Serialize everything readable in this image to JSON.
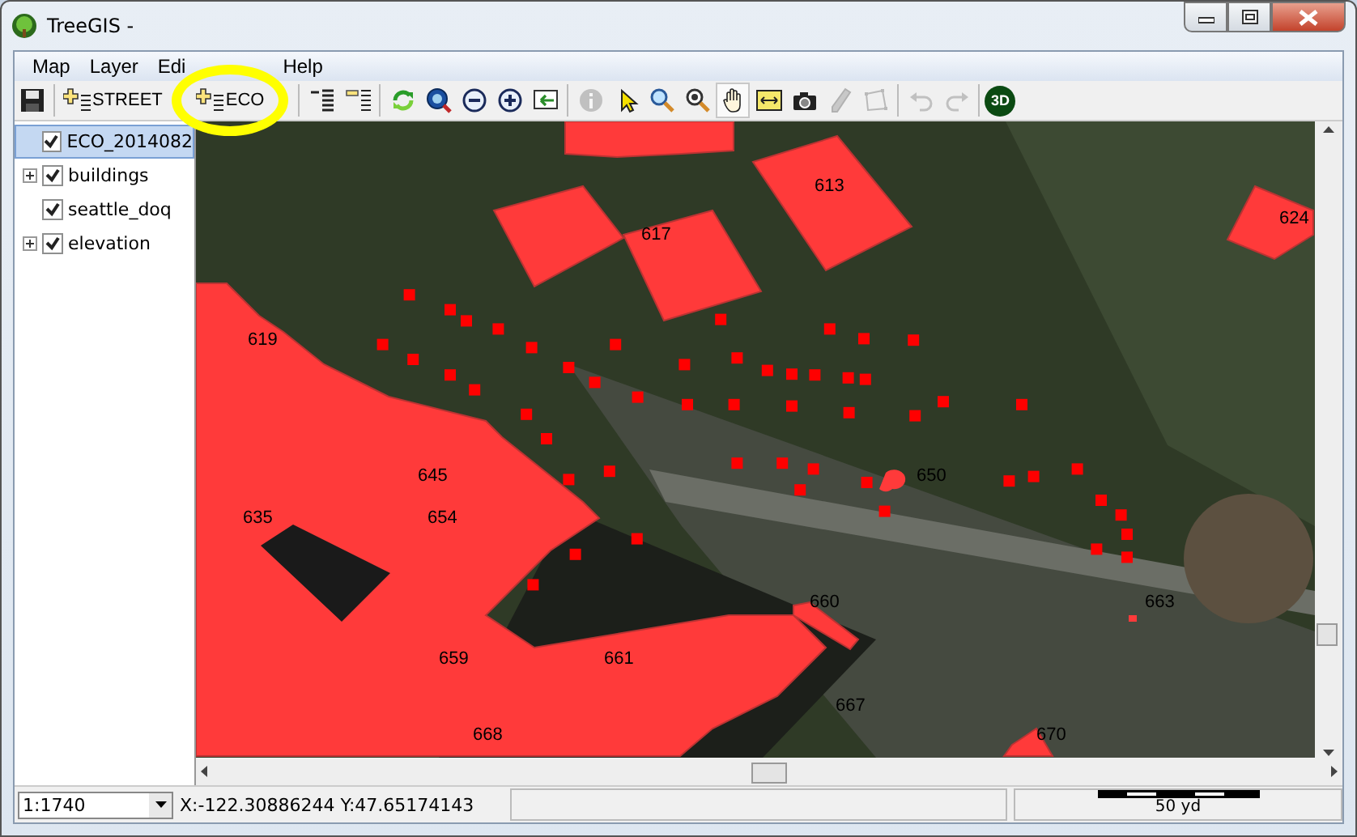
{
  "window": {
    "title": "TreeGIS -"
  },
  "menu": [
    {
      "label": "Map"
    },
    {
      "label": "Layer"
    },
    {
      "label": "Edi"
    },
    {
      "label": "Help"
    }
  ],
  "toolbar": [
    {
      "kind": "icon",
      "disabled": false,
      "selected": false
    },
    {
      "kind": "separator"
    },
    {
      "kind": "layer-button",
      "label": "STREET"
    },
    {
      "kind": "layer-button",
      "label": "ECO"
    },
    {
      "kind": "separator"
    },
    {
      "kind": "icon",
      "disabled": false,
      "selected": false
    },
    {
      "kind": "icon",
      "disabled": false,
      "selected": false
    },
    {
      "kind": "separator"
    },
    {
      "kind": "icon",
      "disabled": false,
      "selected": false
    },
    {
      "kind": "icon",
      "disabled": false,
      "selected": false
    },
    {
      "kind": "icon",
      "disabled": false,
      "selected": false
    },
    {
      "kind": "icon",
      "disabled": false,
      "selected": false
    },
    {
      "kind": "icon",
      "disabled": false,
      "selected": false
    },
    {
      "kind": "separator"
    },
    {
      "kind": "icon",
      "disabled": true,
      "selected": false
    },
    {
      "kind": "icon",
      "disabled": false,
      "selected": false
    },
    {
      "kind": "icon",
      "disabled": false,
      "selected": false
    },
    {
      "kind": "icon",
      "disabled": false,
      "selected": false
    },
    {
      "kind": "icon",
      "disabled": false,
      "selected": true
    },
    {
      "kind": "icon",
      "disabled": false,
      "selected": false
    },
    {
      "kind": "icon",
      "disabled": false,
      "selected": false
    },
    {
      "kind": "icon",
      "disabled": true,
      "selected": false
    },
    {
      "kind": "icon",
      "disabled": true,
      "selected": false
    },
    {
      "kind": "separator"
    },
    {
      "kind": "icon",
      "disabled": true,
      "selected": false
    },
    {
      "kind": "icon",
      "disabled": true,
      "selected": false
    },
    {
      "kind": "separator"
    },
    {
      "kind": "badge",
      "label": "3D"
    }
  ],
  "layers": [
    {
      "name": "ECO_2014082",
      "checked": true,
      "selected": true
    },
    {
      "name": "buildings",
      "checked": true,
      "selected": false,
      "expanded": false
    },
    {
      "name": "seattle_doq",
      "checked": true,
      "selected": false
    },
    {
      "name": "elevation",
      "checked": true,
      "selected": false,
      "expanded": false
    }
  ],
  "map": {
    "buildings": [
      {
        "label": "613"
      },
      {
        "label": "624"
      },
      {
        "label": "617"
      },
      {
        "label": "619"
      },
      {
        "label": "645"
      },
      {
        "label": "650"
      },
      {
        "label": "635"
      },
      {
        "label": "654"
      },
      {
        "label": "660"
      },
      {
        "label": "663"
      },
      {
        "label": "659"
      },
      {
        "label": "661"
      },
      {
        "label": "667"
      },
      {
        "label": "668"
      },
      {
        "label": "670"
      }
    ]
  },
  "status_bar": {
    "scale": "1:1740",
    "coordinates": "X:-122.30886244 Y:47.65174143",
    "scale_bar": "50 yd"
  }
}
